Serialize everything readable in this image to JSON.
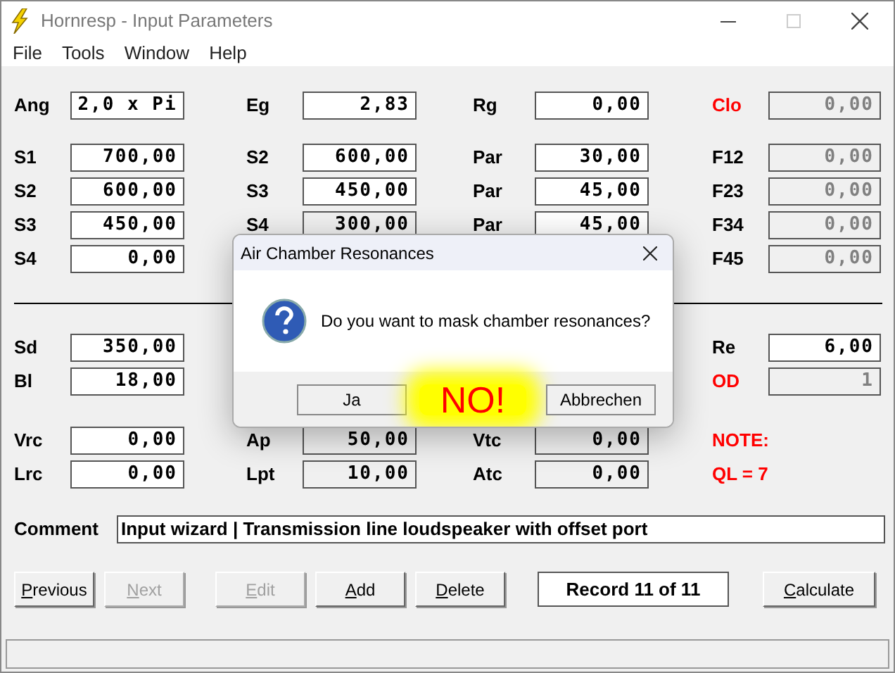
{
  "window": {
    "title": "Hornresp - Input Parameters"
  },
  "menu": [
    "File",
    "Tools",
    "Window",
    "Help"
  ],
  "rows": [
    [
      {
        "label": "Ang",
        "value": "2,0 x Pi",
        "kind": "edit",
        "alert": false
      },
      {
        "label": "Eg",
        "value": "2,83",
        "kind": "edit",
        "alert": false
      },
      {
        "label": "Rg",
        "value": "0,00",
        "kind": "edit",
        "alert": false
      },
      {
        "label": "Clo",
        "value": "0,00",
        "kind": "disabled",
        "alert": true
      }
    ],
    [
      {
        "label": "S1",
        "value": "700,00",
        "kind": "edit",
        "alert": false
      },
      {
        "label": "S2",
        "value": "600,00",
        "kind": "edit",
        "alert": false
      },
      {
        "label": "Par",
        "value": "30,00",
        "kind": "edit",
        "alert": false
      },
      {
        "label": "F12",
        "value": "0,00",
        "kind": "disabled",
        "alert": false
      }
    ],
    [
      {
        "label": "S2",
        "value": "600,00",
        "kind": "edit",
        "alert": false
      },
      {
        "label": "S3",
        "value": "450,00",
        "kind": "edit",
        "alert": false
      },
      {
        "label": "Par",
        "value": "45,00",
        "kind": "edit",
        "alert": false
      },
      {
        "label": "F23",
        "value": "0,00",
        "kind": "disabled",
        "alert": false
      }
    ],
    [
      {
        "label": "S3",
        "value": "450,00",
        "kind": "edit",
        "alert": false
      },
      {
        "label": "S4",
        "value": "300,00",
        "kind": "readonly",
        "alert": false
      },
      {
        "label": "Par",
        "value": "45,00",
        "kind": "edit",
        "alert": false
      },
      {
        "label": "F34",
        "value": "0,00",
        "kind": "disabled",
        "alert": false
      }
    ],
    [
      {
        "label": "S4",
        "value": "0,00",
        "kind": "edit",
        "alert": false
      },
      null,
      null,
      {
        "label": "F45",
        "value": "0,00",
        "kind": "disabled",
        "alert": false
      }
    ],
    [
      {
        "label": "Sd",
        "value": "350,00",
        "kind": "edit",
        "alert": false
      },
      null,
      null,
      {
        "label": "Re",
        "value": "6,00",
        "kind": "edit",
        "alert": false
      }
    ],
    [
      {
        "label": "Bl",
        "value": "18,00",
        "kind": "edit",
        "alert": false
      },
      null,
      null,
      {
        "label": "OD",
        "value": "1",
        "kind": "disabled",
        "alert": true
      }
    ],
    [
      {
        "label": "Vrc",
        "value": "0,00",
        "kind": "edit",
        "alert": false
      },
      {
        "label": "Ap",
        "value": "50,00",
        "kind": "readonly",
        "alert": false
      },
      {
        "label": "Vtc",
        "value": "0,00",
        "kind": "readonly",
        "alert": false
      },
      {
        "label": "NOTE:",
        "kind": "note",
        "alert": true
      }
    ],
    [
      {
        "label": "Lrc",
        "value": "0,00",
        "kind": "edit",
        "alert": false
      },
      {
        "label": "Lpt",
        "value": "10,00",
        "kind": "readonly",
        "alert": false
      },
      {
        "label": "Atc",
        "value": "0,00",
        "kind": "readonly",
        "alert": false
      },
      {
        "label": "QL = 7",
        "kind": "note",
        "alert": true
      }
    ]
  ],
  "comment": {
    "label": "Comment",
    "value": "Input wizard | Transmission line loudspeaker with offset port"
  },
  "buttons": [
    {
      "label": "Previous",
      "kind": "button",
      "disabled": false
    },
    {
      "label": "Next",
      "kind": "button",
      "disabled": true
    },
    {
      "label": "Edit",
      "kind": "button",
      "disabled": true
    },
    {
      "label": "Add",
      "kind": "button",
      "disabled": false
    },
    {
      "label": "Delete",
      "kind": "button",
      "disabled": false
    },
    {
      "label": "Record 11 of 11",
      "kind": "display"
    },
    {
      "label": "Calculate",
      "kind": "button",
      "disabled": false
    }
  ],
  "dialog": {
    "title": "Air Chamber Resonances",
    "message": "Do you want to mask chamber resonances?",
    "buttons": [
      "Ja",
      "Abbrechen"
    ],
    "annotation": "NO!"
  }
}
